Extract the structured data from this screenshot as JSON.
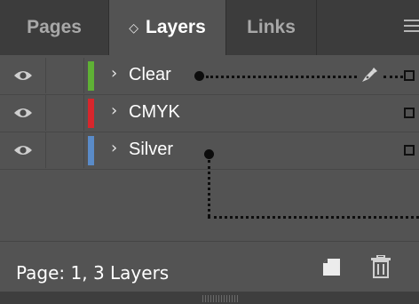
{
  "tabs": [
    {
      "label": "Pages"
    },
    {
      "label": "Layers",
      "active_indicator": "◇"
    },
    {
      "label": "Links"
    }
  ],
  "menu_icon": "hamburger-icon",
  "layers": [
    {
      "name": "Clear",
      "color": "#5fb135",
      "expander": "›",
      "visible": true,
      "targeted": true,
      "has_pen": true
    },
    {
      "name": "CMYK",
      "color": "#d8262c",
      "expander": "›",
      "visible": true,
      "targeted": false,
      "has_pen": false
    },
    {
      "name": "Silver",
      "color": "#5a8bc8",
      "expander": "›",
      "visible": true,
      "targeted": true,
      "has_pen": false
    }
  ],
  "status": {
    "text": "Page: 1, 3 Layers"
  },
  "colors": {
    "panel_bg": "#535353",
    "tabbar_bg": "#3c3c3c",
    "text": "#ffffff"
  }
}
